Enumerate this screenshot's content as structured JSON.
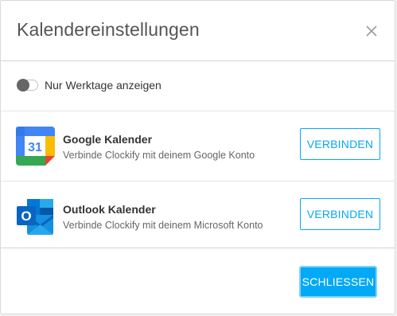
{
  "dialog": {
    "title": "Kalendereinstellungen",
    "close_icon": "close-icon"
  },
  "settings": {
    "weekdays_only_label": "Nur Werktage anzeigen",
    "weekdays_only_enabled": false
  },
  "calendars": [
    {
      "name": "Google Kalender",
      "description": "Verbinde Clockify mit deinem Google Konto",
      "icon": "google-calendar-icon",
      "icon_text": "31",
      "button_label": "VERBINDEN"
    },
    {
      "name": "Outlook Kalender",
      "description": "Verbinde Clockify mit deinem Microsoft Konto",
      "icon": "outlook-icon",
      "icon_text": "O",
      "button_label": "VERBINDEN"
    }
  ],
  "footer": {
    "close_label": "SCHLIESSEN"
  },
  "colors": {
    "accent": "#03a9f4",
    "google_blue": "#4285f4",
    "google_green": "#34a853",
    "google_yellow": "#fbbc04",
    "google_red": "#ea4335",
    "outlook_blue": "#0a64c2"
  }
}
